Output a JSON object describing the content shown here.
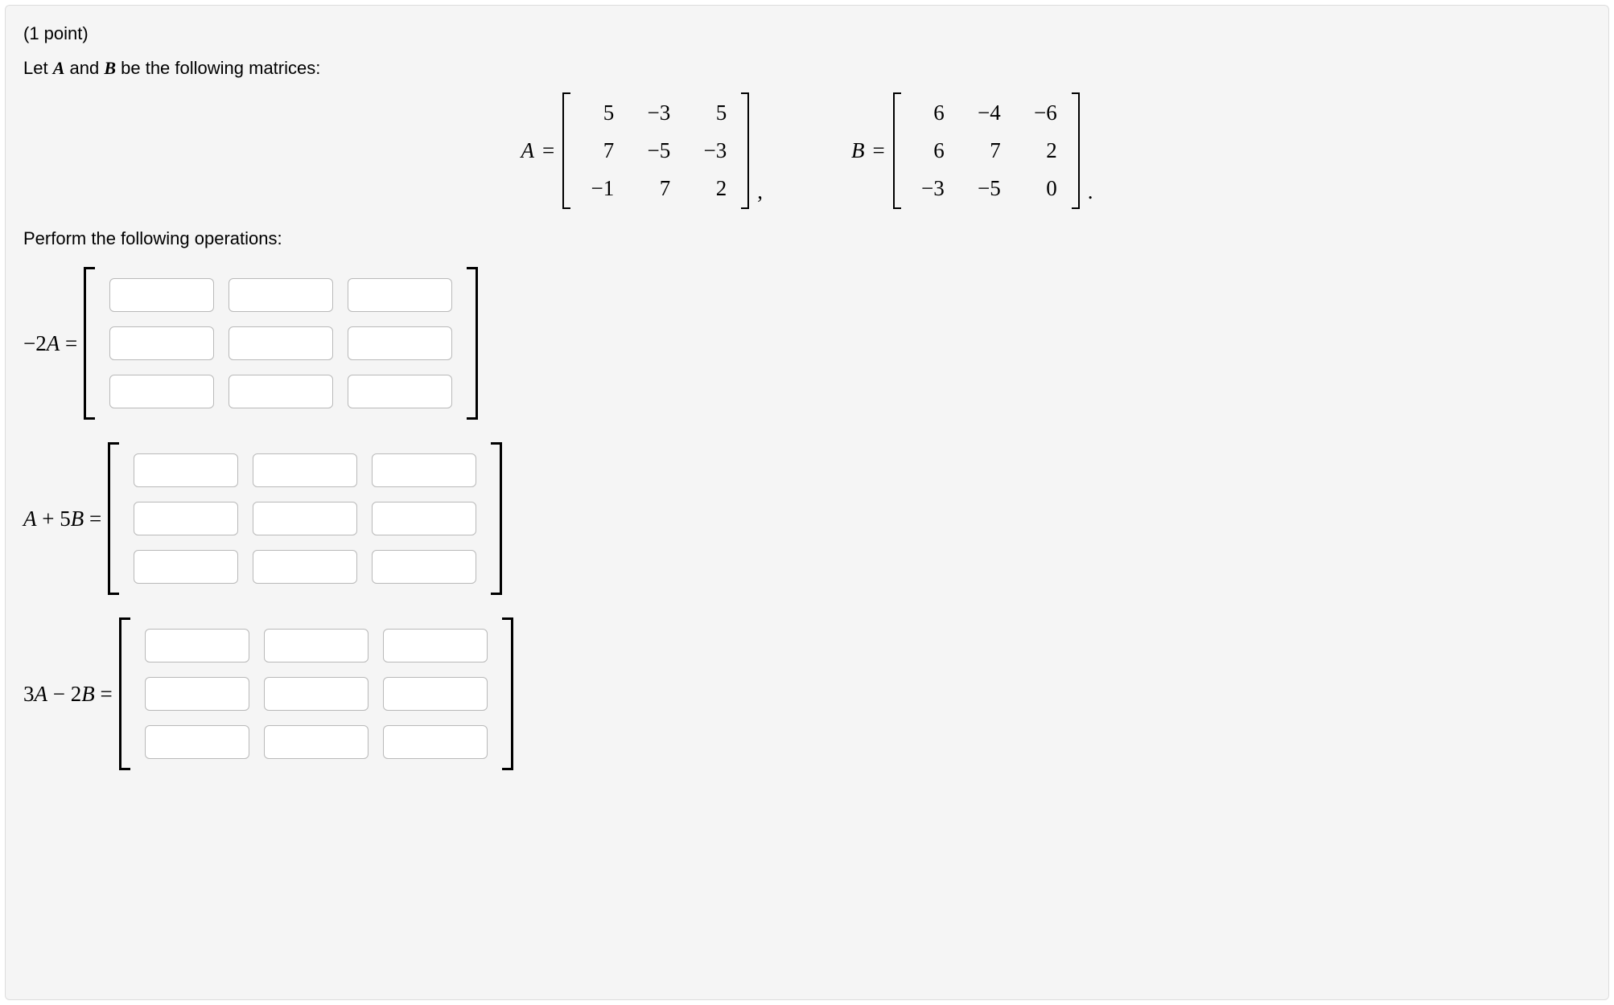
{
  "points_line": "(1 point)",
  "intro_prefix": "Let ",
  "intro_mid": " and ",
  "intro_suffix": " be the following matrices:",
  "var_A": "A",
  "var_B": "B",
  "eq": " = ",
  "comma": ",",
  "period": ".",
  "matrix_A": [
    [
      "5",
      "−3",
      "5"
    ],
    [
      "7",
      "−5",
      "−3"
    ],
    [
      "−1",
      "7",
      "2"
    ]
  ],
  "matrix_B": [
    [
      "6",
      "−4",
      "−6"
    ],
    [
      "6",
      "7",
      "2"
    ],
    [
      "−3",
      "−5",
      "0"
    ]
  ],
  "perform_line": "Perform the following operations:",
  "answers": [
    {
      "label_html": "−2<span class='mathit'>A</span> ="
    },
    {
      "label_html": "<span class='mathit'>A</span> + 5<span class='mathit'>B</span> ="
    },
    {
      "label_html": "3<span class='mathit'>A</span> − 2<span class='mathit'>B</span> ="
    }
  ]
}
